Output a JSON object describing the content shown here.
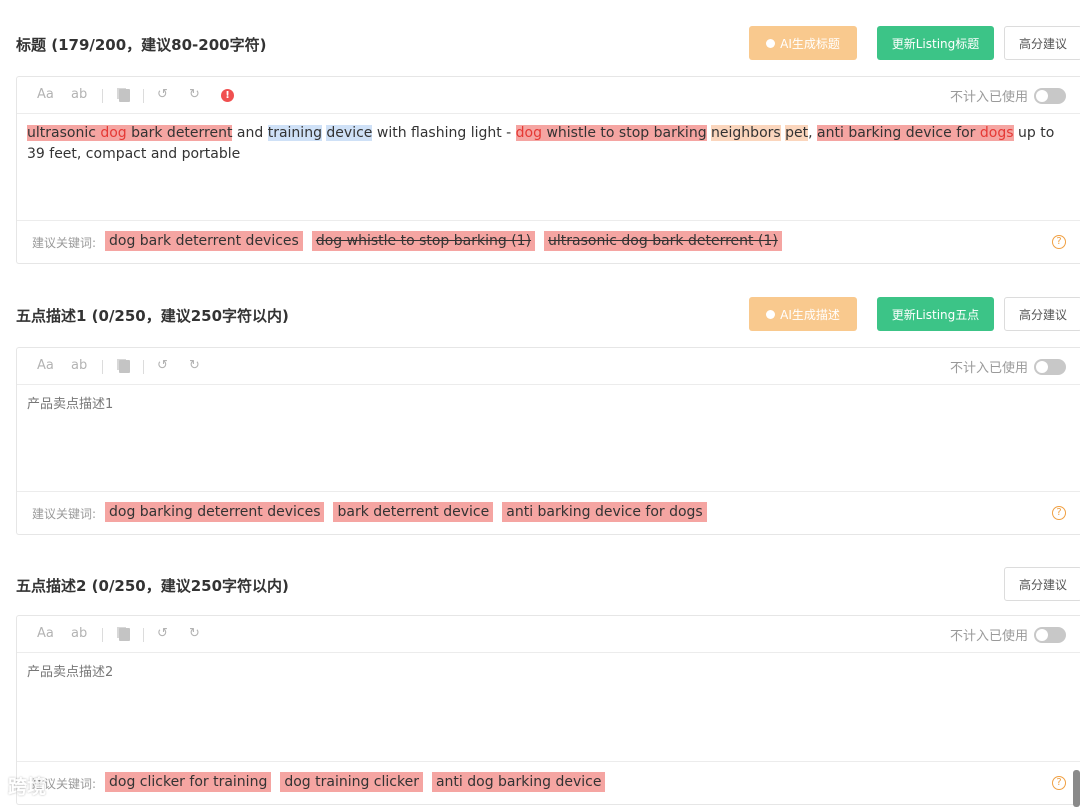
{
  "sections": [
    {
      "title": "标题 (179/200，建议80-200字符)",
      "ai_button": "AI生成标题",
      "update_button": "更新Listing标题",
      "suggest_button": "高分建议",
      "exclude_label": "不计入已使用",
      "content_segments": [
        {
          "text": "ultrasonic ",
          "hl": "red"
        },
        {
          "text": "dog",
          "hl": "red-word"
        },
        {
          "text": " bark deterrent",
          "hl": "red"
        },
        {
          "text": " and ",
          "hl": ""
        },
        {
          "text": "training",
          "hl": "blue"
        },
        {
          "text": " ",
          "hl": ""
        },
        {
          "text": "device",
          "hl": "blue"
        },
        {
          "text": " with flashing light - ",
          "hl": ""
        },
        {
          "text": "dog",
          "hl": "red-word"
        },
        {
          "text": " whistle to stop barking",
          "hl": "red"
        },
        {
          "text": " ",
          "hl": ""
        },
        {
          "text": "neighbors",
          "hl": "peach"
        },
        {
          "text": " ",
          "hl": ""
        },
        {
          "text": "pet",
          "hl": "peach"
        },
        {
          "text": ", ",
          "hl": ""
        },
        {
          "text": "anti barking device for ",
          "hl": "red"
        },
        {
          "text": "dogs",
          "hl": "red-word"
        },
        {
          "text": " up to 39 feet, compact and portable",
          "hl": ""
        }
      ],
      "keywords_label": "建议关键词:",
      "keywords": [
        {
          "text": "dog bark deterrent devices",
          "struck": false
        },
        {
          "text": "dog whistle to stop barking (1)",
          "struck": true
        },
        {
          "text": "ultrasonic dog bark deterrent (1)",
          "struck": true
        }
      ]
    },
    {
      "title": "五点描述1 (0/250，建议250字符以内)",
      "ai_button": "AI生成描述",
      "update_button": "更新Listing五点",
      "suggest_button": "高分建议",
      "exclude_label": "不计入已使用",
      "placeholder": "产品卖点描述1",
      "keywords_label": "建议关键词:",
      "keywords": [
        {
          "text": "dog barking deterrent devices",
          "struck": false
        },
        {
          "text": "bark deterrent device",
          "struck": false
        },
        {
          "text": "anti barking device for dogs",
          "struck": false
        }
      ]
    },
    {
      "title": "五点描述2 (0/250，建议250字符以内)",
      "suggest_button": "高分建议",
      "exclude_label": "不计入已使用",
      "placeholder": "产品卖点描述2",
      "keywords_label": "建议关键词:",
      "keywords": [
        {
          "text": "dog clicker for training",
          "struck": false
        },
        {
          "text": "dog training clicker",
          "struck": false
        },
        {
          "text": "anti dog barking device",
          "struck": false
        }
      ]
    }
  ],
  "toolbar": {
    "case_upper": "Aa",
    "case_lower": "ab",
    "error_icon": "!"
  },
  "help_icon": "?",
  "watermark": "跨境"
}
